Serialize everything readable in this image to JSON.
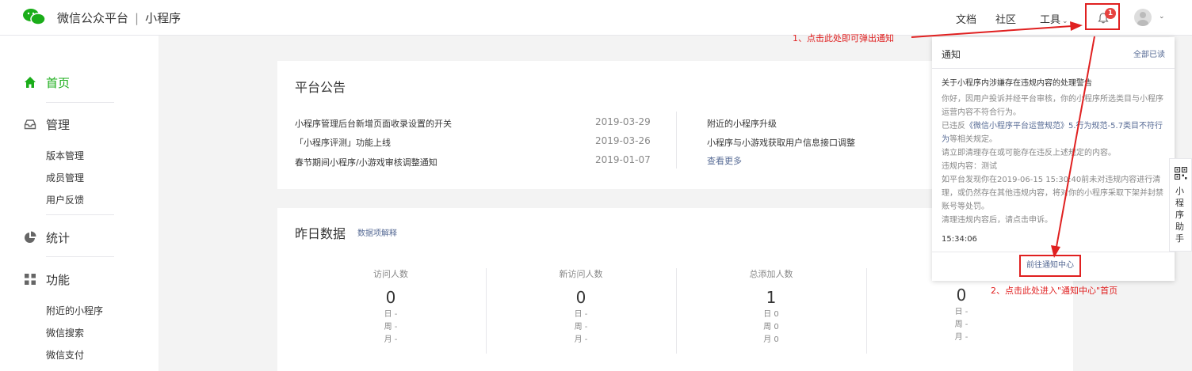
{
  "header": {
    "brand": "微信公众平台",
    "separator": "|",
    "product": "小程序",
    "links": {
      "docs": "文档",
      "community": "社区",
      "tools": "工具"
    },
    "notification_count": "1"
  },
  "sidebar": {
    "home": "首页",
    "manage": "管理",
    "manage_items": [
      "版本管理",
      "成员管理",
      "用户反馈"
    ],
    "stats": "统计",
    "features": "功能",
    "feature_items": [
      "附近的小程序",
      "微信搜索",
      "微信支付"
    ]
  },
  "announcements": {
    "title": "平台公告",
    "left": [
      {
        "text": "小程序管理后台新增页面收录设置的开关",
        "date": "2019-03-29"
      },
      {
        "text": "「小程序评测」功能上线",
        "date": "2019-03-26"
      },
      {
        "text": "春节期间小程序/小游戏审核调整通知",
        "date": "2019-01-07"
      }
    ],
    "right": [
      "附近的小程序升级",
      "小程序与小游戏获取用户信息接口调整"
    ],
    "more": "查看更多"
  },
  "yesterday": {
    "title": "昨日数据",
    "explain": "数据项解释",
    "stats": [
      {
        "label": "访问人数",
        "value": "0",
        "day": "日  -",
        "week": "周  -",
        "month": "月  -"
      },
      {
        "label": "新访问人数",
        "value": "0",
        "day": "日  -",
        "week": "周  -",
        "month": "月  -"
      },
      {
        "label": "总添加人数",
        "value": "1",
        "day": "日  0",
        "week": "周  0",
        "month": "月  0"
      },
      {
        "label": "",
        "value": "0",
        "day": "日  -",
        "week": "周  -",
        "month": "月  -"
      }
    ]
  },
  "popup": {
    "title": "通知",
    "mark_all": "全部已读",
    "msg_title": "关于小程序内涉嫌存在违规内容的处理警告",
    "line1": "你好，因用户投诉并经平台审核，你的小程序所选类目与小程序运营内容不符合行为。",
    "line2_prefix": "已违反",
    "line2_link": "《微信小程序平台运营规范》5.行为规范-5.7类目不符行为",
    "line2_suffix": "等相关规定。",
    "line3": "请立即清理存在或可能存在违反上述规定的内容。",
    "line4": "违规内容：测试",
    "line5": "如平台发现你在2019-06-15 15:30:40前未对违规内容进行清理，或仍然存在其他违规内容，将对你的小程序采取下架并封禁账号等处罚。",
    "line6": "清理违规内容后，请点击申诉。",
    "time": "15:34:06",
    "goto": "前往通知中心"
  },
  "assistant": {
    "label": "小程序助手"
  },
  "annotations": {
    "step1": "1、点击此处即可弹出通知",
    "step2": "2、点击此处进入\"通知中心\"首页"
  },
  "colors": {
    "accent": "#1aad19",
    "link": "#576b95",
    "annotation": "#e02020",
    "badge": "#e64340"
  }
}
